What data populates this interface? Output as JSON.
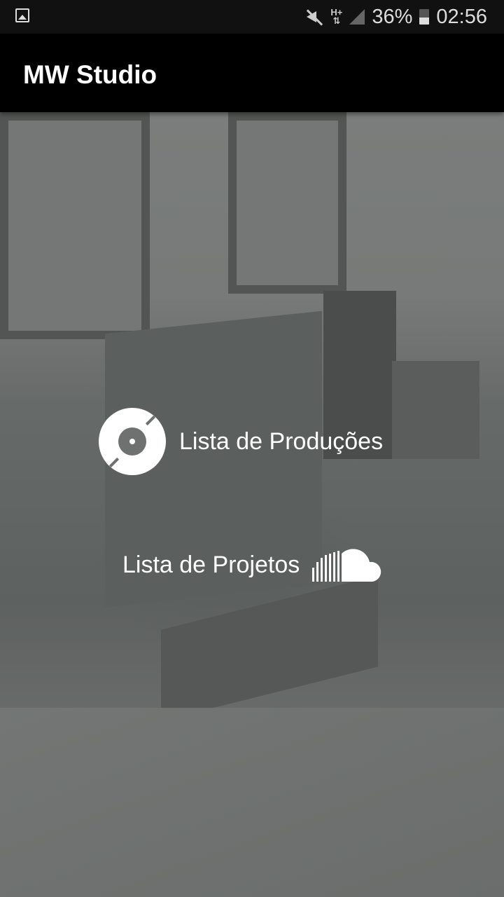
{
  "status_bar": {
    "notification_icon": "gallery-icon",
    "mute_icon": "mute-icon",
    "network": "H+",
    "signal_icon": "signal-icon",
    "battery": "36%",
    "battery_icon": "battery-charging-icon",
    "time": "02:56"
  },
  "app_bar": {
    "title": "MW Studio"
  },
  "menu": [
    {
      "label": "Lista de Produções",
      "icon": "disc-icon"
    },
    {
      "label": "Lista de Projetos",
      "icon": "soundcloud-icon"
    }
  ],
  "colors": {
    "app_bar": "#000000",
    "overlay": "#6e716f",
    "text": "#ffffff"
  }
}
